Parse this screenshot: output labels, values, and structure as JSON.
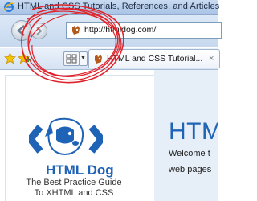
{
  "window": {
    "title": "HTML and CSS Tutorials, References, and Articles"
  },
  "navigation": {
    "back_icon": "back-arrow-icon",
    "forward_icon": "forward-arrow-icon",
    "address": "http://htmldog.com/"
  },
  "tabs": {
    "favorites_icon": "favorites-star-icon",
    "add_favorite_icon": "add-favorite-icon",
    "quick_tabs_icon": "quick-tabs-icon",
    "tab_list_icon": "chevron-down-icon",
    "active_tab": {
      "title": "HTML and CSS Tutorial...",
      "close_glyph": "×"
    }
  },
  "page": {
    "logo_name": "HTML Dog",
    "tagline_line1": "The Best Practice Guide",
    "tagline_line2": "To XHTML and CSS",
    "heading": "HTM",
    "text_line1": "Welcome t",
    "text_line2": "web pages"
  },
  "colors": {
    "brand_blue": "#1f63b6",
    "annotation_red": "#e0232b"
  }
}
